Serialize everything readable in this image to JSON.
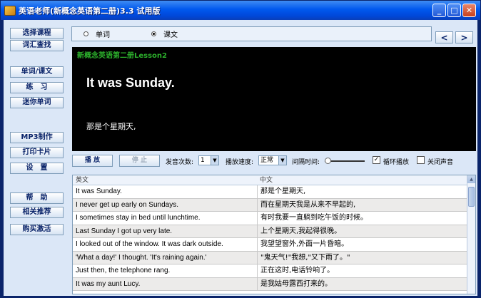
{
  "window": {
    "title": "英语老师(新概念英语第二册)3.3 试用版",
    "controls": {
      "minimize": "_",
      "maximize": "□",
      "close": "✕"
    }
  },
  "sidebar": {
    "items": [
      "选择课程",
      "词汇查找",
      "单词/课文",
      "练　习",
      "迷你单词",
      "MP3制作",
      "打印卡片",
      "设　置",
      "帮　助",
      "相关推荐",
      "购买激活"
    ]
  },
  "mode": {
    "options": [
      {
        "label": "单词",
        "selected": false
      },
      {
        "label": "课文",
        "selected": true
      }
    ],
    "prev": "<",
    "next": ">"
  },
  "display": {
    "lesson_title": "新概念英语第二册Lesson2",
    "english": "It was Sunday.",
    "chinese": "那是个星期天,"
  },
  "controls": {
    "play_label": "播 放",
    "stop_label": "停 止",
    "repeat_label": "发音次数:",
    "repeat_value": "1",
    "speed_label": "播放速度:",
    "speed_value": "正常",
    "interval_label": "间隔时间:",
    "interval_level": 0,
    "loop_label": "循环播放",
    "loop_checked": true,
    "mute_label": "关闭声音",
    "mute_checked": false
  },
  "table": {
    "headers": {
      "english": "英文",
      "chinese": "中文"
    },
    "rows": [
      {
        "en": "It was Sunday.",
        "cn": "那是个星期天,"
      },
      {
        "en": "I never get up early on Sundays.",
        "cn": "而在星期天我是从来不早起的,"
      },
      {
        "en": "I sometimes stay in bed until lunchtime.",
        "cn": "有时我要一直躺到吃午饭的时候。"
      },
      {
        "en": "Last Sunday I got up very late.",
        "cn": "上个星期天,我起得很晚。"
      },
      {
        "en": "I looked out of the window. It was dark outside.",
        "cn": "我望望窗外,外面一片昏暗。"
      },
      {
        "en": "'What a day!' I thought. 'It's raining again.'",
        "cn": "\"鬼天气!\"我想,\"又下雨了。\""
      },
      {
        "en": "Just then, the telephone rang.",
        "cn": "正在这时,电话铃响了。"
      },
      {
        "en": "It was my aunt Lucy.",
        "cn": "是我姑母露西打来的。"
      }
    ]
  }
}
